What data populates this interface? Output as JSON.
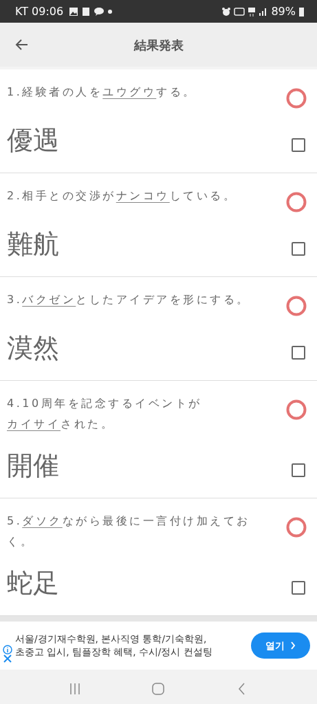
{
  "status_bar": {
    "carrier_time": "KT 09:06",
    "battery": "89%"
  },
  "header": {
    "title": "結果発表"
  },
  "questions": [
    {
      "before": "1.経験者の人を",
      "underlined": "ユウグウ",
      "after": "する。",
      "answer": "優遇",
      "correct": true,
      "checked": false
    },
    {
      "before": "2.相手との交渉が",
      "underlined": "ナンコウ",
      "after": "している。",
      "answer": "難航",
      "correct": true,
      "checked": false
    },
    {
      "before": "3.",
      "underlined": "バクゼン",
      "after": "としたアイデアを形にする。",
      "answer": "漠然",
      "correct": true,
      "checked": false
    },
    {
      "before": "4.10周年を記念するイベントが",
      "underlined": "カイサイ",
      "after": "された。",
      "answer": "開催",
      "correct": true,
      "checked": false
    },
    {
      "before": "5.",
      "underlined": "ダソク",
      "after": "ながら最後に一言付け加えておく。",
      "answer": "蛇足",
      "correct": true,
      "checked": false
    }
  ],
  "ad": {
    "text": "서울/경기재수학원, 본사직영 통학/기숙학원, 초중고 입시, 팀플장학 혜택, 수시/정시 컨설팅",
    "button": "열기"
  }
}
